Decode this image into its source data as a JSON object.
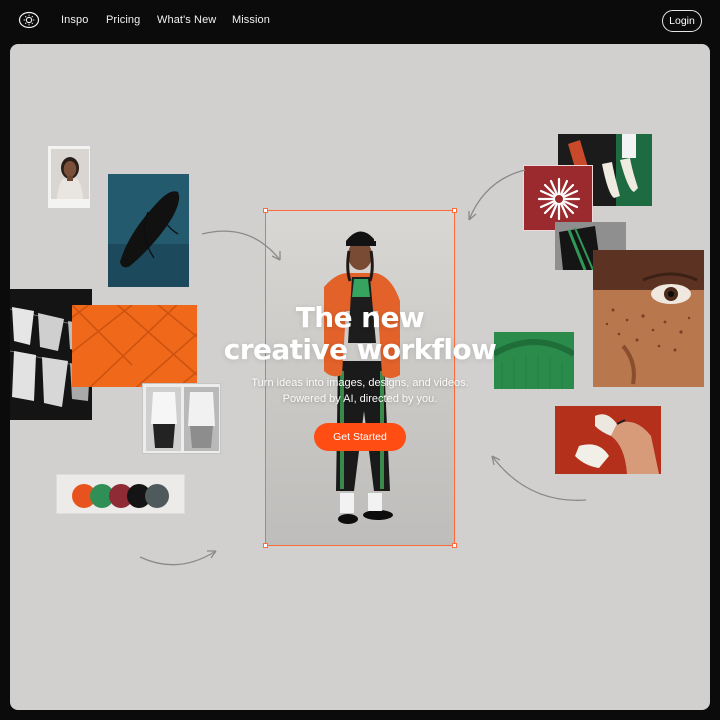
{
  "nav": {
    "logo_icon": "sun-outline-icon",
    "links": [
      "Inspo",
      "Pricing",
      "What's New",
      "Mission"
    ],
    "login_label": "Login"
  },
  "hero": {
    "title_line1": "The new",
    "title_line2": "creative workflow",
    "subtitle_line1": "Turn ideas into images, designs, and videos.",
    "subtitle_line2": "Powered by AI, directed by you.",
    "cta_label": "Get Started"
  },
  "palette": {
    "swatches": [
      "#e8521f",
      "#2f8f57",
      "#8e2b34",
      "#141414",
      "#4f5a5c"
    ]
  },
  "colors": {
    "accent": "#ff4d14",
    "canvas": "#d1d0ce",
    "frame": "#ff6a3d",
    "nav_bg": "#0b0b0b"
  },
  "icons": [
    "sun-outline-icon",
    "starburst-icon",
    "curved-arrow-icon"
  ]
}
